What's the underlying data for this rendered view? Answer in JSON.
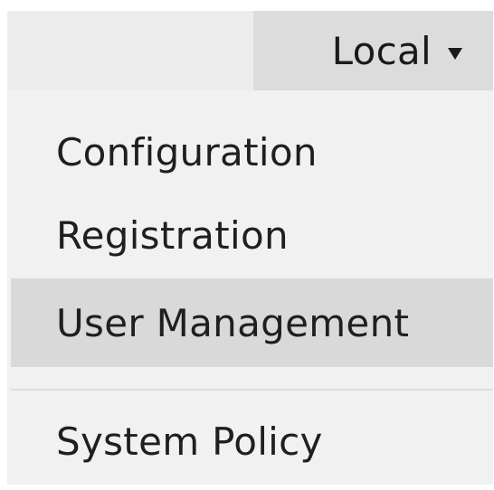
{
  "dropdown": {
    "label": "Local",
    "caret_icon": "caret-down-icon"
  },
  "menu": {
    "items": [
      {
        "label": "Configuration",
        "selected": false
      },
      {
        "label": "Registration",
        "selected": false
      },
      {
        "label": "User Management",
        "selected": true
      },
      {
        "label": "System Policy",
        "selected": false
      }
    ]
  },
  "colors": {
    "top_bar": "#ececec",
    "toggle_bg": "#dcdcdc",
    "menu_bg": "#f1f1f1",
    "selected_bg": "#d9d9d9",
    "text": "#1f1f1f"
  }
}
